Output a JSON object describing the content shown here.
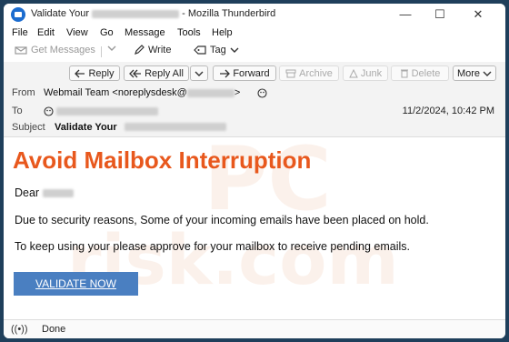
{
  "window": {
    "title_prefix": "Validate Your",
    "title_suffix": "- Mozilla Thunderbird",
    "minimize": "—",
    "maximize": "☐",
    "close": "✕"
  },
  "menu": [
    "File",
    "Edit",
    "View",
    "Go",
    "Message",
    "Tools",
    "Help"
  ],
  "toolbar": {
    "get_messages": "Get Messages",
    "write": "Write",
    "tag": "Tag"
  },
  "header_buttons": {
    "reply": "Reply",
    "reply_all": "Reply All",
    "forward": "Forward",
    "archive": "Archive",
    "junk": "Junk",
    "delete": "Delete",
    "more": "More"
  },
  "header": {
    "from_label": "From",
    "from_name": "Webmail Team <noreplysdesk@",
    "from_end": ">",
    "to_label": "To",
    "date": "11/2/2024, 10:42 PM",
    "subject_label": "Subject",
    "subject_value": "Validate Your"
  },
  "email": {
    "headline": "Avoid Mailbox Interruption",
    "greeting": "Dear",
    "para1": "Due to security reasons, Some of your incoming emails have been placed on hold.",
    "para2": "To keep using your please approve for your mailbox to receive pending emails.",
    "cta": "VALIDATE NOW"
  },
  "status": {
    "text": "Done"
  },
  "colors": {
    "headline": "#e8581d",
    "cta_bg": "#4a7fc1",
    "watermark": "#f5d9c8"
  }
}
